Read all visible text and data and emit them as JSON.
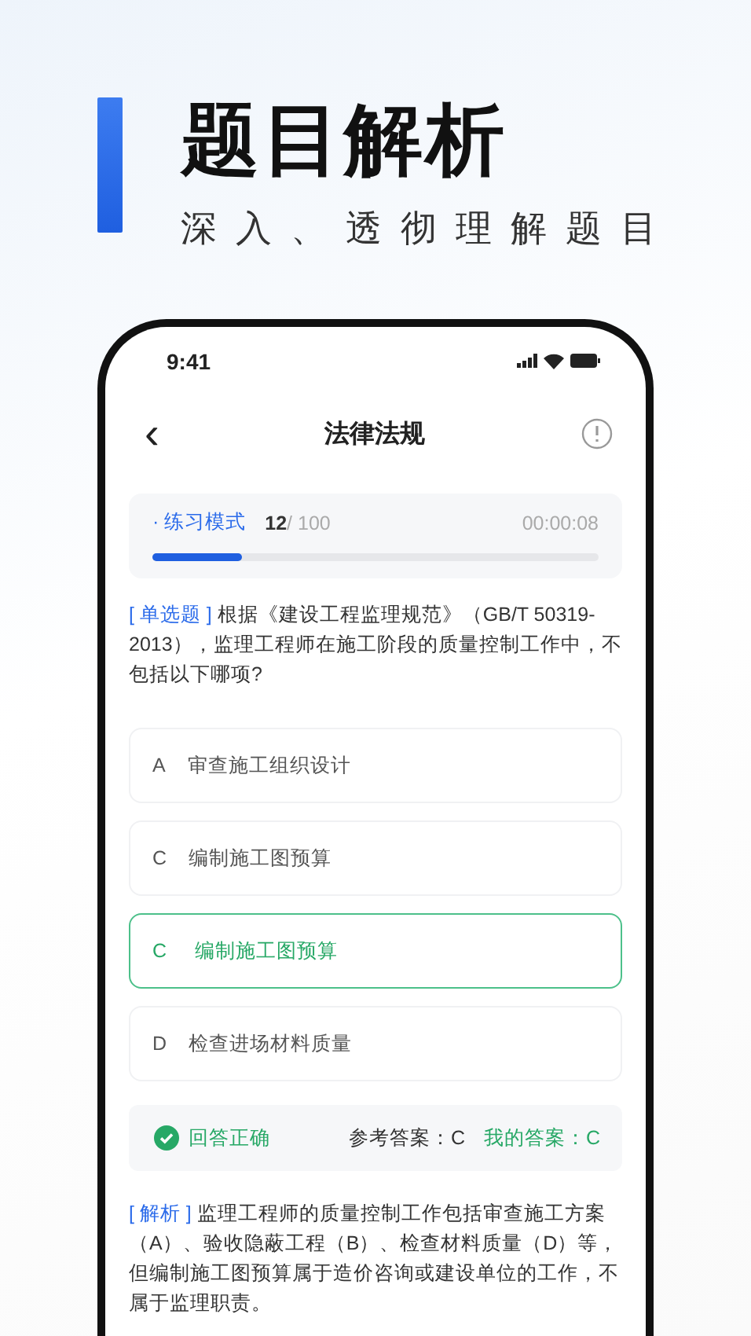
{
  "promo": {
    "title": "题目解析",
    "subtitle": "深入、透彻理解题目"
  },
  "status_bar": {
    "time": "9:41"
  },
  "nav": {
    "back": "‹",
    "title": "法律法规"
  },
  "progress": {
    "mode": "· 练习模式",
    "current": "12",
    "total": "/ 100",
    "timer": "00:00:08",
    "level": 0.2
  },
  "question": {
    "tag": "[ 单选题 ]",
    "text": "根据《建设工程监理规范》（GB/T 50319-2013），监理工程师在施工阶段的质量控制工作中，不包括以下哪项?"
  },
  "options": [
    {
      "letter": "A",
      "text": "审查施工组织设计",
      "selected": false
    },
    {
      "letter": "C",
      "text": "编制施工图预算",
      "selected": false
    },
    {
      "letter": "C",
      "text": "编制施工图预算",
      "selected": true
    },
    {
      "letter": "D",
      "text": "检查进场材料质量",
      "selected": false
    }
  ],
  "result": {
    "correct": true,
    "status": "回答正确",
    "reference": "参考答案：C",
    "mine": "我的答案：C"
  },
  "explanation": {
    "tag": "[ 解析 ]",
    "text": "监理工程师的质量控制工作包括审查施工方案（A）、验收隐蔽工程（B）、检查材料质量（D）等，但编制施工图预算属于造价咨询或建设单位的工作，不属于监理职责。"
  }
}
